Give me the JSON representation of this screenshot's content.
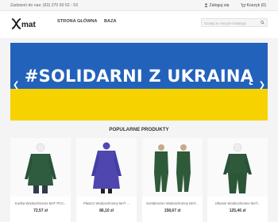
{
  "topbar": {
    "contact": "Zadzwoń do nas: (63) 270 60 52 - 53",
    "login": "Zaloguj się",
    "cart": "Koszyk (0)"
  },
  "header": {
    "logo_text": "mat",
    "nav": [
      "STRONA GŁÓWNA",
      "BAZA"
    ],
    "search_placeholder": "Szukaj w naszym katalogu"
  },
  "banner": {
    "slogan": "#SOLIDARNI Z UKRAINĄ",
    "colors": {
      "top": "#2362bb",
      "bottom": "#f5d200"
    }
  },
  "section": {
    "title": "POPULARNE PRODUKTY"
  },
  "products": [
    {
      "name": "Kurtka Wodoochronna MAT PCV...",
      "price": "72,57 zł",
      "color": "#2f5b3e"
    },
    {
      "name": "Płaszcz Wodoochronny MAT ...",
      "price": "86,10 zł",
      "color": "#4f46b0"
    },
    {
      "name": "Kombinezon Wodoochronny MAT...",
      "price": "158,67 zł",
      "color": "#2e5a3a"
    },
    {
      "name": "Ubranie Wodoochronne MAT...",
      "price": "125,46 zł",
      "color": "#2e5a3a"
    }
  ]
}
